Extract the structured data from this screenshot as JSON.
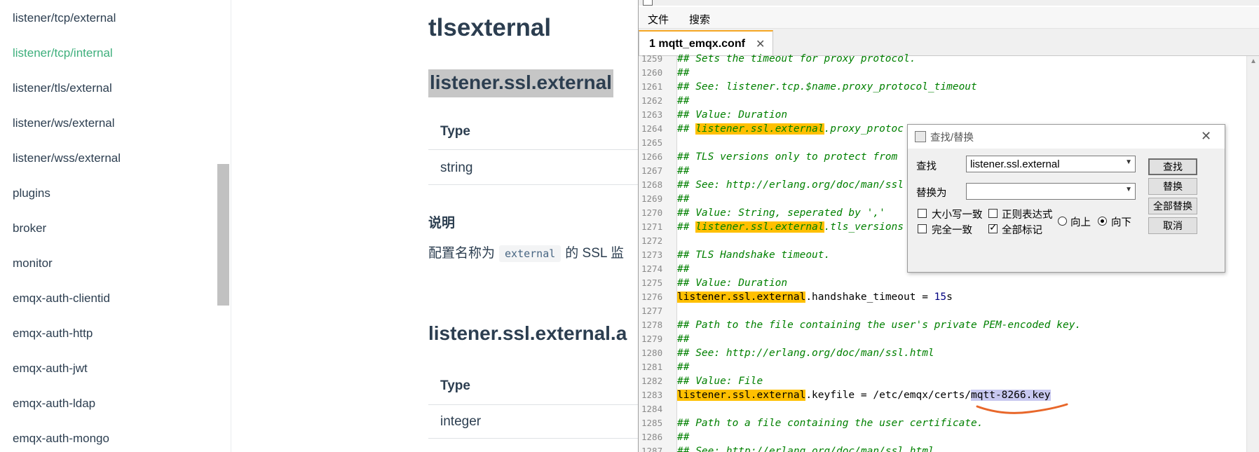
{
  "sidebar": {
    "items": [
      {
        "label": "listener/tcp/external"
      },
      {
        "label": "listener/tcp/internal"
      },
      {
        "label": "listener/tls/external"
      },
      {
        "label": "listener/ws/external"
      },
      {
        "label": "listener/wss/external"
      },
      {
        "label": "plugins"
      },
      {
        "label": "broker"
      },
      {
        "label": "monitor"
      },
      {
        "label": "emqx-auth-clientid"
      },
      {
        "label": "emqx-auth-http"
      },
      {
        "label": "emqx-auth-jwt"
      },
      {
        "label": "emqx-auth-ldap"
      },
      {
        "label": "emqx-auth-mongo"
      }
    ],
    "active_index": 1,
    "active_color": "#3eaf7c"
  },
  "docs": {
    "heading": "tlsexternal",
    "section1_title": "listener.ssl.external",
    "table1": {
      "header": "Type",
      "value": "string"
    },
    "desc_heading": "说明",
    "desc_before": "配置名称为",
    "desc_code": "external",
    "desc_after": "的 SSL 监",
    "section2_title": "listener.ssl.external.a",
    "table2": {
      "header": "Type",
      "value": "integer"
    }
  },
  "editor": {
    "menu": [
      "文件",
      "搜索"
    ],
    "tab_label": "1 mqtt_emqx.conf",
    "tab_close": "✕",
    "highlight_color": "#ffc000",
    "lines": [
      {
        "n": "1259",
        "segs": [
          {
            "t": "## Sets the timeout for proxy protocol.",
            "c": "cm"
          }
        ]
      },
      {
        "n": "1260",
        "segs": [
          {
            "t": "##",
            "c": "cm"
          }
        ]
      },
      {
        "n": "1261",
        "segs": [
          {
            "t": "## See: listener.tcp.$name.proxy_protocol_timeout",
            "c": "cm"
          }
        ]
      },
      {
        "n": "1262",
        "segs": [
          {
            "t": "##",
            "c": "cm"
          }
        ]
      },
      {
        "n": "1263",
        "segs": [
          {
            "t": "## Value: Duration",
            "c": "cm"
          }
        ]
      },
      {
        "n": "1264",
        "segs": [
          {
            "t": "## ",
            "c": "cm"
          },
          {
            "t": "listener.ssl.external",
            "c": "cm hl"
          },
          {
            "t": ".proxy_protoc",
            "c": "cm"
          }
        ]
      },
      {
        "n": "1265",
        "segs": []
      },
      {
        "n": "1266",
        "segs": [
          {
            "t": "## TLS versions only to protect from",
            "c": "cm"
          }
        ]
      },
      {
        "n": "1267",
        "segs": [
          {
            "t": "##",
            "c": "cm"
          }
        ]
      },
      {
        "n": "1268",
        "segs": [
          {
            "t": "## See: http://erlang.org/doc/man/ssl",
            "c": "cm"
          }
        ]
      },
      {
        "n": "1269",
        "segs": [
          {
            "t": "##",
            "c": "cm"
          }
        ]
      },
      {
        "n": "1270",
        "segs": [
          {
            "t": "## Value: String, seperated by ','",
            "c": "cm"
          }
        ]
      },
      {
        "n": "1271",
        "segs": [
          {
            "t": "## ",
            "c": "cm"
          },
          {
            "t": "listener.ssl.external",
            "c": "cm hl"
          },
          {
            "t": ".tls_versions",
            "c": "cm"
          }
        ]
      },
      {
        "n": "1272",
        "segs": []
      },
      {
        "n": "1273",
        "segs": [
          {
            "t": "## TLS Handshake timeout.",
            "c": "cm"
          }
        ]
      },
      {
        "n": "1274",
        "segs": [
          {
            "t": "##",
            "c": "cm"
          }
        ]
      },
      {
        "n": "1275",
        "segs": [
          {
            "t": "## Value: Duration",
            "c": "cm"
          }
        ]
      },
      {
        "n": "1276",
        "segs": [
          {
            "t": "listener.ssl.external",
            "c": "hl"
          },
          {
            "t": ".handshake_timeout = ",
            "c": ""
          },
          {
            "t": "15",
            "c": "num"
          },
          {
            "t": "s",
            "c": ""
          }
        ]
      },
      {
        "n": "1277",
        "segs": []
      },
      {
        "n": "1278",
        "segs": [
          {
            "t": "## Path to the file containing the user's private PEM-encoded key.",
            "c": "cm"
          }
        ]
      },
      {
        "n": "1279",
        "segs": [
          {
            "t": "##",
            "c": "cm"
          }
        ]
      },
      {
        "n": "1280",
        "segs": [
          {
            "t": "## See: http://erlang.org/doc/man/ssl.html",
            "c": "cm"
          }
        ]
      },
      {
        "n": "1281",
        "segs": [
          {
            "t": "##",
            "c": "cm"
          }
        ]
      },
      {
        "n": "1282",
        "segs": [
          {
            "t": "## Value: File",
            "c": "cm"
          }
        ]
      },
      {
        "n": "1283",
        "segs": [
          {
            "t": "listener.ssl.external",
            "c": "hl"
          },
          {
            "t": ".keyfile = /etc/emqx/certs/",
            "c": ""
          },
          {
            "t": "mqtt-8266.key",
            "c": "sel"
          }
        ]
      },
      {
        "n": "1284",
        "segs": []
      },
      {
        "n": "1285",
        "segs": [
          {
            "t": "## Path to a file containing the user certificate.",
            "c": "cm"
          }
        ]
      },
      {
        "n": "1286",
        "segs": [
          {
            "t": "##",
            "c": "cm"
          }
        ]
      },
      {
        "n": "1287",
        "segs": [
          {
            "t": "## See: http://erlang.org/doc/man/ssl.html",
            "c": "cm"
          }
        ]
      }
    ]
  },
  "find_dialog": {
    "title": "查找/替换",
    "close": "✕",
    "find_label": "查找",
    "find_value": "listener.ssl.external",
    "replace_label": "替换为",
    "replace_value": "",
    "buttons": {
      "find": "查找",
      "replace": "替换",
      "replace_all": "全部替换",
      "cancel": "取消"
    },
    "options": {
      "match_case": {
        "label": "大小写一致",
        "checked": false
      },
      "regex": {
        "label": "正则表达式",
        "checked": false
      },
      "whole_word": {
        "label": "完全一致",
        "checked": false
      },
      "mark_all": {
        "label": "全部标记",
        "checked": true
      },
      "dir_up": {
        "label": "向上",
        "selected": false
      },
      "dir_down": {
        "label": "向下",
        "selected": true
      }
    }
  }
}
